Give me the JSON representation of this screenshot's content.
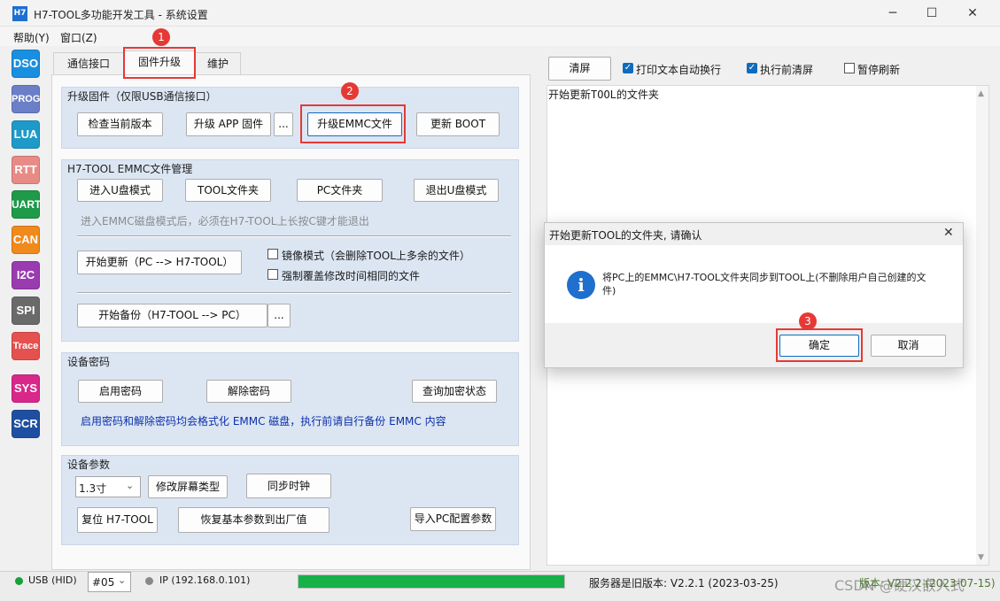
{
  "window": {
    "app_icon": "H7",
    "title": "H7-TOOL多功能开发工具 - 系统设置",
    "minimize": "─",
    "maximize": "☐",
    "close": "✕"
  },
  "menu": [
    "帮助(Y)",
    "窗口(Z)"
  ],
  "sidebar": [
    {
      "label": "DSO",
      "color": "#1a8fe0"
    },
    {
      "label": "PROG",
      "color": "#6b7fc8"
    },
    {
      "label": "LUA",
      "color": "#1e9ac9"
    },
    {
      "label": "RTT",
      "color": "#e88b86"
    },
    {
      "label": "UART",
      "color": "#1e9a49"
    },
    {
      "label": "CAN",
      "color": "#f08a1c"
    },
    {
      "label": "I2C",
      "color": "#9b3bb0"
    },
    {
      "label": "SPI",
      "color": "#6a6a6a"
    },
    {
      "label": "Trace",
      "color": "#e5514e"
    },
    {
      "label": "SYS",
      "color": "#d9278a"
    },
    {
      "label": "SCR",
      "color": "#1f4fa0"
    }
  ],
  "tabs": [
    "通信接口",
    "固件升级",
    "维护"
  ],
  "firmware_group": {
    "title": "升级固件（仅限USB通信接口）",
    "check_version": "检查当前版本",
    "upgrade_app": "升级 APP 固件",
    "browse": "...",
    "upgrade_emmc": "升级EMMC文件",
    "update_boot": "更新 BOOT"
  },
  "emmc_group": {
    "title": "H7-TOOL EMMC文件管理",
    "enter_udisk": "进入U盘模式",
    "tool_folder": "TOOL文件夹",
    "pc_folder": "PC文件夹",
    "exit_udisk": "退出U盘模式",
    "hint": "进入EMMC磁盘模式后，必须在H7-TOOL上长按C键才能退出",
    "start_update": "开始更新（PC --> H7-TOOL）",
    "mirror_mode": "镜像模式（会删除TOOL上多余的文件）",
    "force_overwrite": "强制覆盖修改时间相同的文件",
    "start_backup": "开始备份（H7-TOOL --> PC）",
    "browse": "..."
  },
  "password_group": {
    "title": "设备密码",
    "enable": "启用密码",
    "disable": "解除密码",
    "query": "查询加密状态",
    "note": "启用密码和解除密码均会格式化 EMMC 磁盘，执行前请自行备份 EMMC 内容"
  },
  "params_group": {
    "title": "设备参数",
    "screen_size": "1.3寸",
    "change_screen": "修改屏幕类型",
    "sync_clock": "同步时钟",
    "reset": "复位 H7-TOOL",
    "factory": "恢复基本参数到出厂值",
    "import_pc": "导入PC配置参数"
  },
  "right_toolbar": {
    "clear": "清屏",
    "wrap": "打印文本自动换行",
    "clear_before": "执行前清屏",
    "pause": "暂停刷新"
  },
  "log_text": "开始更新TOOL的文件夹",
  "dialog": {
    "title": "开始更新TOOL的文件夹, 请确认",
    "icon": "i",
    "message": "将PC上的EMMC\\H7-TOOL文件夹同步到TOOL上(不删除用户自己创建的文件)",
    "ok": "确定",
    "cancel": "取消"
  },
  "annotations": [
    "1",
    "2",
    "3"
  ],
  "status": {
    "usb": "USB (HID)",
    "port": "#05",
    "ip": "IP (192.168.0.101)",
    "progress": 1.0,
    "server": "服务器是旧版本: V2.2.1 (2023-03-25)",
    "version": "版本: V2.2.2 (2023-07-15)",
    "watermark": "CSDN @硬汉嵌入式"
  },
  "colors": {
    "accent": "#1f6fce",
    "progress": "#16b148",
    "annotation": "#e53935",
    "note_text": "#0b2fa8"
  }
}
